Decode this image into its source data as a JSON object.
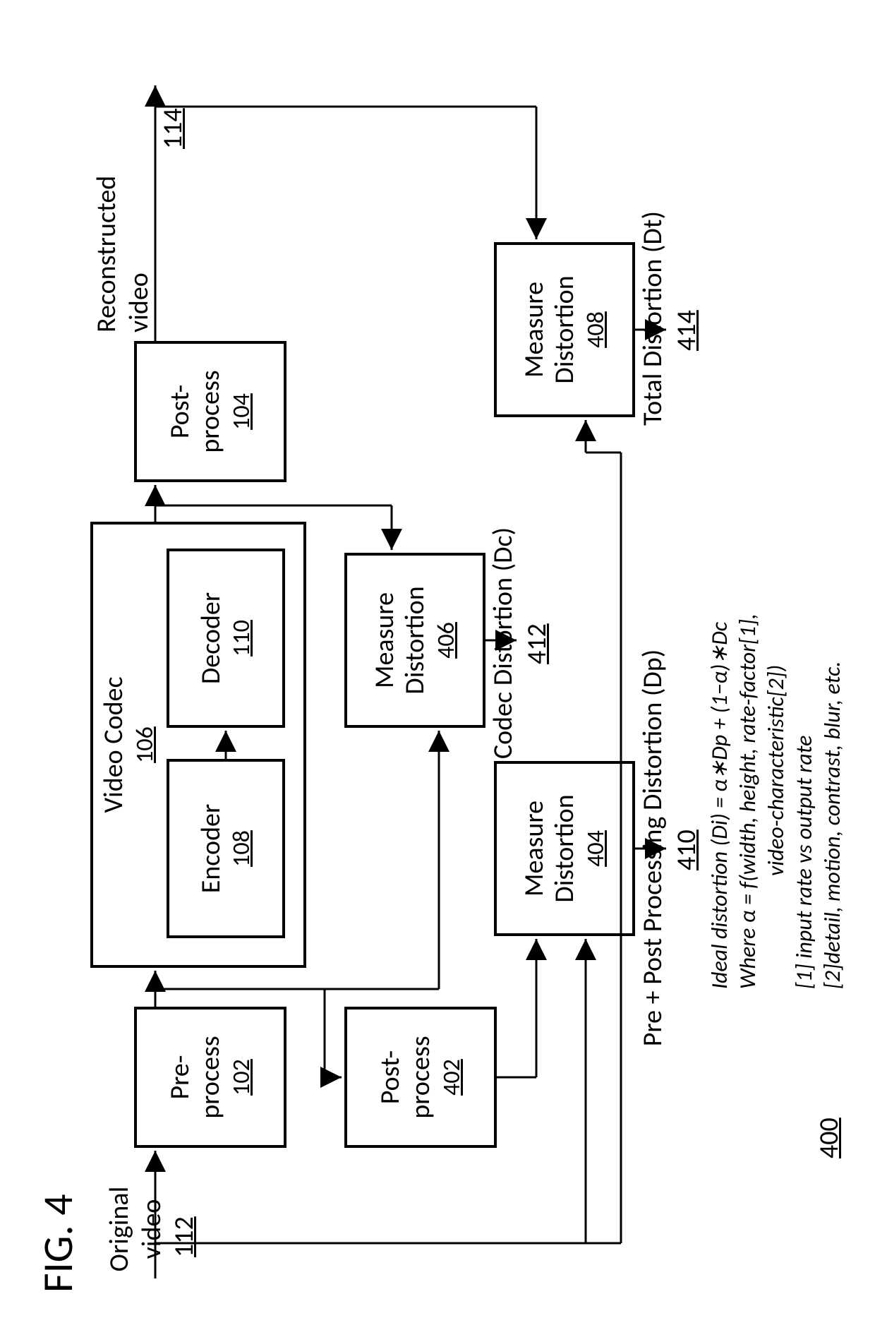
{
  "figure_title": "FIG. 4",
  "labels": {
    "original_video": "Original video",
    "original_video_ref": "112",
    "reconstructed_video": "Reconstructed video",
    "reconstructed_video_ref": "114",
    "video_codec": "Video Codec",
    "video_codec_ref": "106",
    "codec_distortion": "Codec Distortion (Dc)",
    "codec_distortion_ref": "412",
    "pp_distortion": "Pre + Post Processing Distortion (Dp)",
    "pp_distortion_ref": "410",
    "total_distortion": "Total Distortion (Dt)",
    "total_distortion_ref": "414",
    "diagram_ref": "400"
  },
  "blocks": {
    "pre": {
      "line1": "Pre-",
      "line2": "process",
      "ref": "102"
    },
    "encoder": {
      "line1": "Encoder",
      "ref": "108"
    },
    "decoder": {
      "line1": "Decoder",
      "ref": "110"
    },
    "post": {
      "line1": "Post-",
      "line2": "process",
      "ref": "104"
    },
    "post2": {
      "line1": "Post-",
      "line2": "process",
      "ref": "402"
    },
    "md404": {
      "line1": "Measure",
      "line2": "Distortion",
      "ref": "404"
    },
    "md406": {
      "line1": "Measure",
      "line2": "Distortion",
      "ref": "406"
    },
    "md408": {
      "line1": "Measure",
      "line2": "Distortion",
      "ref": "408"
    }
  },
  "notes": {
    "l1": "Ideal distortion (Di) = α∗Dp + (1−α)∗Dc",
    "l2": "Where α = f(width, height, rate-factor[1],",
    "l3": "video-characteristic[2])",
    "l4": "[1] input rate vs output rate",
    "l5": "[2]detail, motion, contrast, blur, etc."
  }
}
